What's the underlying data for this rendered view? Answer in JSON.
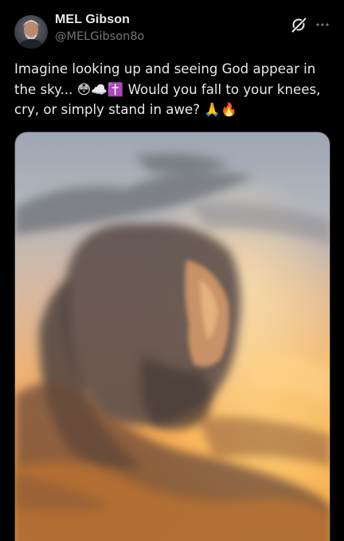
{
  "post": {
    "author": {
      "display_name": "MEL Gibson",
      "handle": "@MELGibson8o"
    },
    "text_lines": [
      "Imagine looking up and seeing God appear in",
      "the sky... 😳☁️✝️ Would you fall to your knees,",
      "cry, or simply stand in awe? 🙏🔥"
    ],
    "icons": {
      "grok": "grok-icon",
      "more": "more-icon"
    },
    "media": {
      "type": "image",
      "subject": "cloud formation resembling a bearded face at sunset"
    }
  },
  "colors": {
    "background": "#000000",
    "primary_text": "#e7e9ea",
    "secondary_text": "#71767b",
    "border": "#2f3336"
  }
}
